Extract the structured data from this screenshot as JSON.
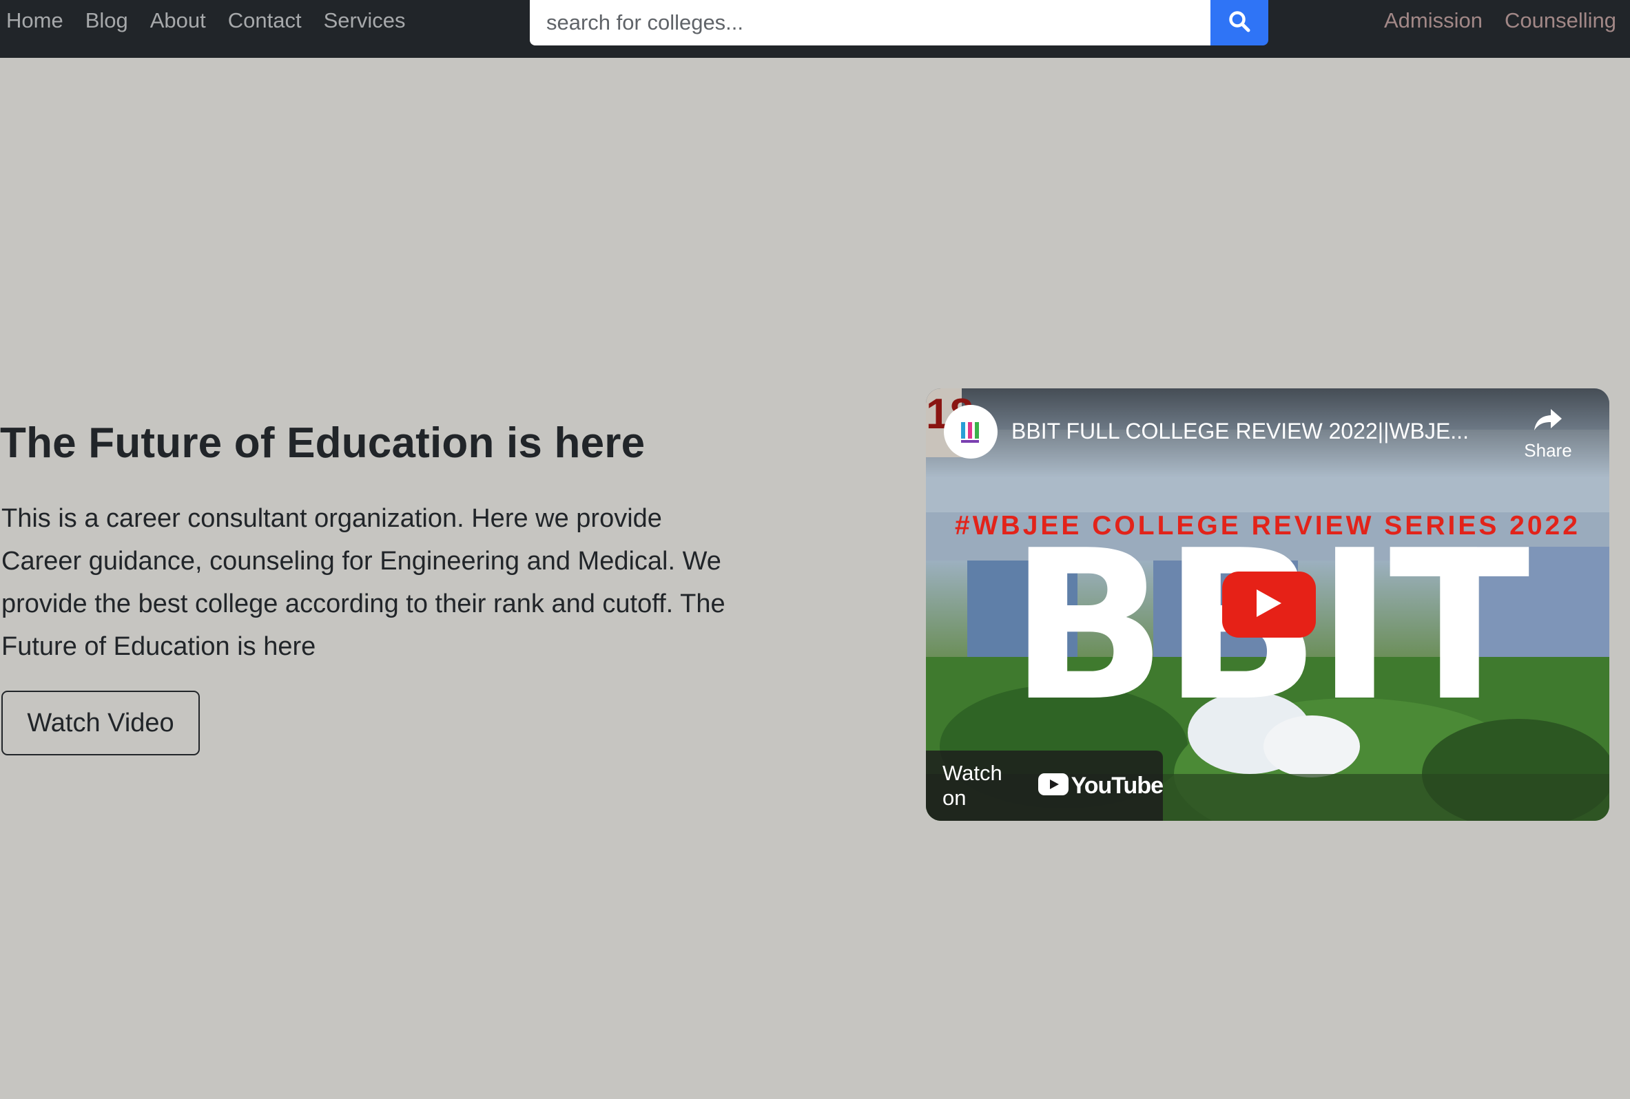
{
  "navbar": {
    "left_links": [
      "Home",
      "Blog",
      "About",
      "Contact",
      "Services"
    ],
    "search": {
      "placeholder": "search for colleges...",
      "value": "",
      "button_icon": "search-icon"
    },
    "right_links": [
      "Admission",
      "Counselling"
    ]
  },
  "hero": {
    "title": "The Future of Education is here",
    "description": "This is a career consultant organization. Here we provide Career guidance, counseling for Engineering and Medical. We provide the best college according to their rank and cutoff. The Future of Education is here",
    "button_label": "Watch Video"
  },
  "video": {
    "title": "BBIT FULL COLLEGE REVIEW 2022||WBJE...",
    "share_label": "Share",
    "thumbnail_banner": "#WBJEE COLLEGE REVIEW SERIES 2022",
    "thumbnail_big_text": "BBIT",
    "watch_on_label": "Watch on",
    "platform_name": "YouTube",
    "edge_fragment": "18"
  },
  "colors": {
    "navbar_bg": "#212529",
    "page_bg": "#c6c5c1",
    "search_button": "#2f74f6",
    "right_link": "#a28887",
    "play_button": "#e62117",
    "banner_text": "#e2231a"
  }
}
